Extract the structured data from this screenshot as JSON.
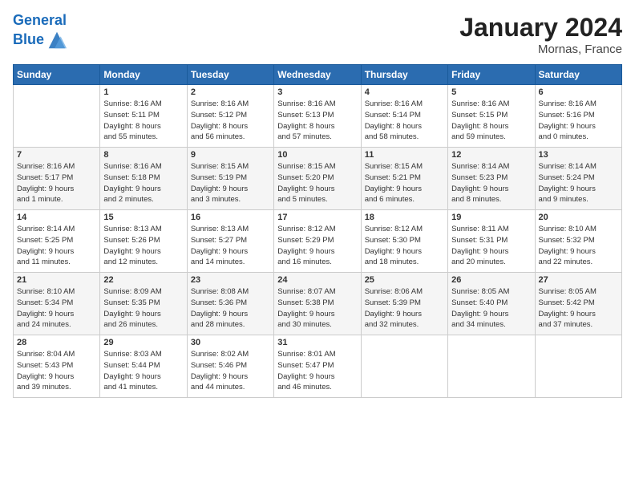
{
  "header": {
    "logo_line1": "General",
    "logo_line2": "Blue",
    "title": "January 2024",
    "subtitle": "Mornas, France"
  },
  "days_of_week": [
    "Sunday",
    "Monday",
    "Tuesday",
    "Wednesday",
    "Thursday",
    "Friday",
    "Saturday"
  ],
  "weeks": [
    [
      {
        "day": "",
        "info": ""
      },
      {
        "day": "1",
        "info": "Sunrise: 8:16 AM\nSunset: 5:11 PM\nDaylight: 8 hours\nand 55 minutes."
      },
      {
        "day": "2",
        "info": "Sunrise: 8:16 AM\nSunset: 5:12 PM\nDaylight: 8 hours\nand 56 minutes."
      },
      {
        "day": "3",
        "info": "Sunrise: 8:16 AM\nSunset: 5:13 PM\nDaylight: 8 hours\nand 57 minutes."
      },
      {
        "day": "4",
        "info": "Sunrise: 8:16 AM\nSunset: 5:14 PM\nDaylight: 8 hours\nand 58 minutes."
      },
      {
        "day": "5",
        "info": "Sunrise: 8:16 AM\nSunset: 5:15 PM\nDaylight: 8 hours\nand 59 minutes."
      },
      {
        "day": "6",
        "info": "Sunrise: 8:16 AM\nSunset: 5:16 PM\nDaylight: 9 hours\nand 0 minutes."
      }
    ],
    [
      {
        "day": "7",
        "info": "Sunrise: 8:16 AM\nSunset: 5:17 PM\nDaylight: 9 hours\nand 1 minute."
      },
      {
        "day": "8",
        "info": "Sunrise: 8:16 AM\nSunset: 5:18 PM\nDaylight: 9 hours\nand 2 minutes."
      },
      {
        "day": "9",
        "info": "Sunrise: 8:15 AM\nSunset: 5:19 PM\nDaylight: 9 hours\nand 3 minutes."
      },
      {
        "day": "10",
        "info": "Sunrise: 8:15 AM\nSunset: 5:20 PM\nDaylight: 9 hours\nand 5 minutes."
      },
      {
        "day": "11",
        "info": "Sunrise: 8:15 AM\nSunset: 5:21 PM\nDaylight: 9 hours\nand 6 minutes."
      },
      {
        "day": "12",
        "info": "Sunrise: 8:14 AM\nSunset: 5:23 PM\nDaylight: 9 hours\nand 8 minutes."
      },
      {
        "day": "13",
        "info": "Sunrise: 8:14 AM\nSunset: 5:24 PM\nDaylight: 9 hours\nand 9 minutes."
      }
    ],
    [
      {
        "day": "14",
        "info": "Sunrise: 8:14 AM\nSunset: 5:25 PM\nDaylight: 9 hours\nand 11 minutes."
      },
      {
        "day": "15",
        "info": "Sunrise: 8:13 AM\nSunset: 5:26 PM\nDaylight: 9 hours\nand 12 minutes."
      },
      {
        "day": "16",
        "info": "Sunrise: 8:13 AM\nSunset: 5:27 PM\nDaylight: 9 hours\nand 14 minutes."
      },
      {
        "day": "17",
        "info": "Sunrise: 8:12 AM\nSunset: 5:29 PM\nDaylight: 9 hours\nand 16 minutes."
      },
      {
        "day": "18",
        "info": "Sunrise: 8:12 AM\nSunset: 5:30 PM\nDaylight: 9 hours\nand 18 minutes."
      },
      {
        "day": "19",
        "info": "Sunrise: 8:11 AM\nSunset: 5:31 PM\nDaylight: 9 hours\nand 20 minutes."
      },
      {
        "day": "20",
        "info": "Sunrise: 8:10 AM\nSunset: 5:32 PM\nDaylight: 9 hours\nand 22 minutes."
      }
    ],
    [
      {
        "day": "21",
        "info": "Sunrise: 8:10 AM\nSunset: 5:34 PM\nDaylight: 9 hours\nand 24 minutes."
      },
      {
        "day": "22",
        "info": "Sunrise: 8:09 AM\nSunset: 5:35 PM\nDaylight: 9 hours\nand 26 minutes."
      },
      {
        "day": "23",
        "info": "Sunrise: 8:08 AM\nSunset: 5:36 PM\nDaylight: 9 hours\nand 28 minutes."
      },
      {
        "day": "24",
        "info": "Sunrise: 8:07 AM\nSunset: 5:38 PM\nDaylight: 9 hours\nand 30 minutes."
      },
      {
        "day": "25",
        "info": "Sunrise: 8:06 AM\nSunset: 5:39 PM\nDaylight: 9 hours\nand 32 minutes."
      },
      {
        "day": "26",
        "info": "Sunrise: 8:05 AM\nSunset: 5:40 PM\nDaylight: 9 hours\nand 34 minutes."
      },
      {
        "day": "27",
        "info": "Sunrise: 8:05 AM\nSunset: 5:42 PM\nDaylight: 9 hours\nand 37 minutes."
      }
    ],
    [
      {
        "day": "28",
        "info": "Sunrise: 8:04 AM\nSunset: 5:43 PM\nDaylight: 9 hours\nand 39 minutes."
      },
      {
        "day": "29",
        "info": "Sunrise: 8:03 AM\nSunset: 5:44 PM\nDaylight: 9 hours\nand 41 minutes."
      },
      {
        "day": "30",
        "info": "Sunrise: 8:02 AM\nSunset: 5:46 PM\nDaylight: 9 hours\nand 44 minutes."
      },
      {
        "day": "31",
        "info": "Sunrise: 8:01 AM\nSunset: 5:47 PM\nDaylight: 9 hours\nand 46 minutes."
      },
      {
        "day": "",
        "info": ""
      },
      {
        "day": "",
        "info": ""
      },
      {
        "day": "",
        "info": ""
      }
    ]
  ]
}
